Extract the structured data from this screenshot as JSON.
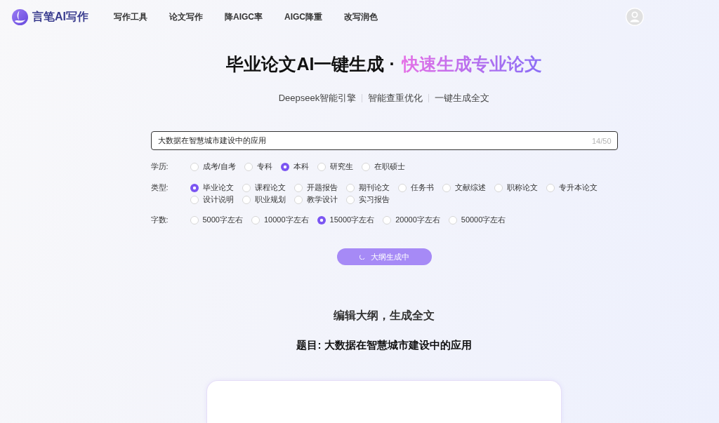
{
  "header": {
    "logo_text": "言笔AI写作",
    "nav": [
      "写作工具",
      "论文写作",
      "降AIGC率",
      "AIGC降重",
      "改写润色"
    ]
  },
  "hero": {
    "title": "毕业论文AI一键生成 ·",
    "title_highlight": "快速生成专业论文",
    "features": [
      "Deepseek智能引擎",
      "智能查重优化",
      "一键生成全文"
    ]
  },
  "form": {
    "topic": {
      "value": "大数据在智慧城市建设中的应用",
      "counter": "14/50"
    },
    "groups": [
      {
        "label": "学历:",
        "options": [
          {
            "label": "成考/自考",
            "selected": false
          },
          {
            "label": "专科",
            "selected": false
          },
          {
            "label": "本科",
            "selected": true
          },
          {
            "label": "研究生",
            "selected": false
          },
          {
            "label": "在职硕士",
            "selected": false
          }
        ]
      },
      {
        "label": "类型:",
        "options": [
          {
            "label": "毕业论文",
            "selected": true
          },
          {
            "label": "课程论文",
            "selected": false
          },
          {
            "label": "开题报告",
            "selected": false
          },
          {
            "label": "期刊论文",
            "selected": false
          },
          {
            "label": "任务书",
            "selected": false
          },
          {
            "label": "文献综述",
            "selected": false
          },
          {
            "label": "职称论文",
            "selected": false
          },
          {
            "label": "专升本论文",
            "selected": false
          },
          {
            "label": "设计说明",
            "selected": false
          },
          {
            "label": "职业规划",
            "selected": false
          },
          {
            "label": "教学设计",
            "selected": false
          },
          {
            "label": "实习报告",
            "selected": false
          }
        ]
      },
      {
        "label": "字数:",
        "options": [
          {
            "label": "5000字左右",
            "selected": false
          },
          {
            "label": "10000字左右",
            "selected": false
          },
          {
            "label": "15000字左右",
            "selected": true
          },
          {
            "label": "20000字左右",
            "selected": false
          },
          {
            "label": "50000字左右",
            "selected": false
          }
        ]
      }
    ],
    "submit": {
      "label": "大纲生成中",
      "loading": true
    }
  },
  "outline": {
    "heading": "编辑大纲，生成全文",
    "topic_title": "题目: 大数据在智慧城市建设中的应用"
  }
}
